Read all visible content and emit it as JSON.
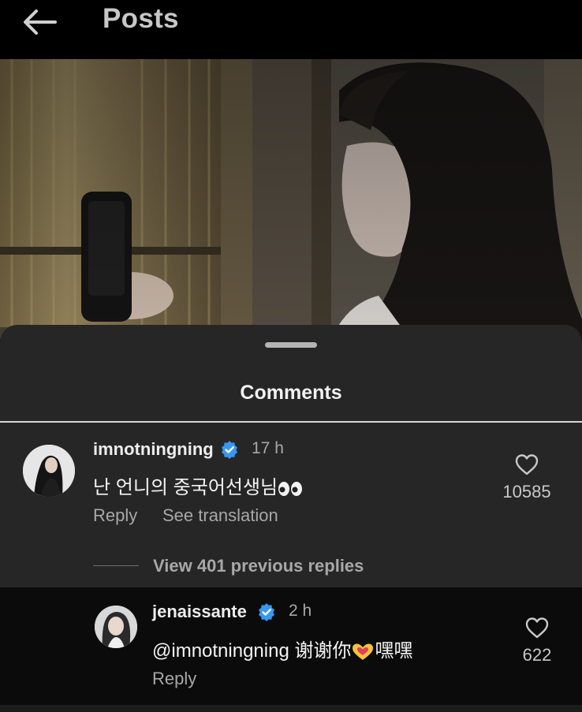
{
  "header": {
    "title": "Posts"
  },
  "sheet": {
    "title": "Comments"
  },
  "comments": [
    {
      "username": "imnotningning",
      "time": "17 h",
      "text": "난 언니의 중국어선생님",
      "text_emoji": "eyes-emoji",
      "likes": "10585",
      "reply_label": "Reply",
      "translate_label": "See translation"
    }
  ],
  "view_replies": "View 401 previous replies",
  "reply": {
    "username": "jenaissante",
    "time": "2 h",
    "mention": "@imnotningning",
    "text_before": "谢谢你",
    "text_emoji": "heart-hands-emoji",
    "text_after": "嘿嘿",
    "likes": "622",
    "reply_label": "Reply"
  },
  "colors": {
    "background": "#000000",
    "sheet": "#262626",
    "verified": "#3897f0"
  }
}
